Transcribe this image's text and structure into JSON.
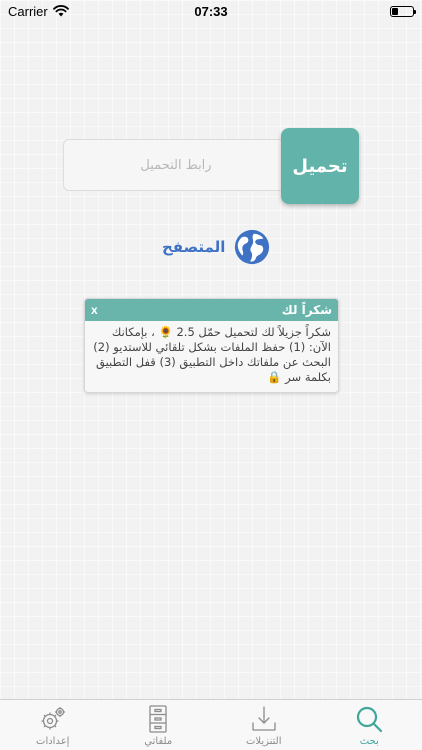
{
  "status_bar": {
    "carrier": "Carrier",
    "time": "07:33",
    "battery_level": 0.3
  },
  "download": {
    "url_placeholder": "رابط التحميل",
    "url_value": "",
    "button_label": "تحميل"
  },
  "browser": {
    "label": "المتصفح",
    "icon": "globe-icon"
  },
  "dialog": {
    "title": "شكراً لك",
    "close_label": "x",
    "body": "شكراً جزيلاً لك لتحميل حمّل 2.5 🌻 ، بإمكانك الآن: (1) حفظ الملفات بشكل تلقائي للاستديو (2) البحث عن ملفاتك داخل التطبيق (3) قفل التطبيق بكلمة سر 🔒"
  },
  "tabs": [
    {
      "label": "بحث",
      "icon": "search-icon",
      "active": true
    },
    {
      "label": "التنزيلات",
      "icon": "download-icon",
      "active": false
    },
    {
      "label": "ملفاتي",
      "icon": "cabinet-icon",
      "active": false
    },
    {
      "label": "إعدادات",
      "icon": "gear-icon",
      "active": false
    }
  ],
  "colors": {
    "accent": "#62b3a9",
    "browser_blue": "#3f72c5",
    "active_tab": "#3ea79a",
    "inactive_tab": "#8c8c8c"
  }
}
